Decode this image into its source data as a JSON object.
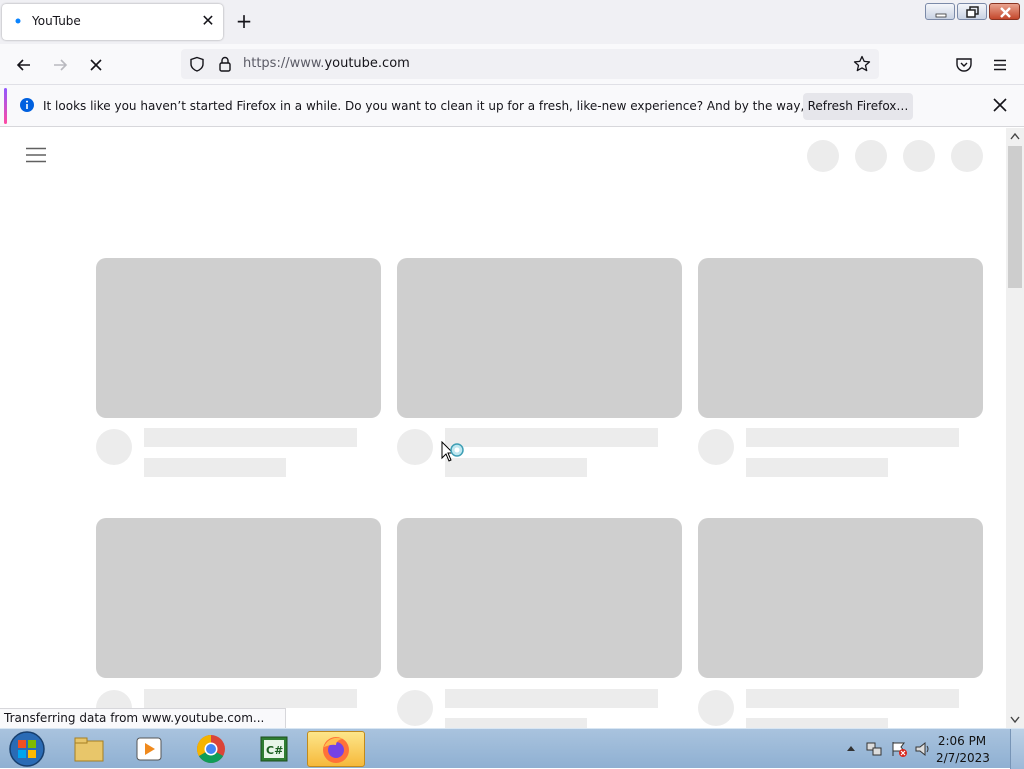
{
  "browser": {
    "tab_title": "YouTube",
    "new_tab_symbol": "+",
    "url_scheme": "https://www.",
    "url_host": "youtube.com",
    "status_text": "Transferring data from www.youtube.com..."
  },
  "notification": {
    "message": "It looks like you haven’t started Firefox in a while. Do you want to clean it up for a fresh, like-new experience? And by the way, welcome back!",
    "button_label": "Refresh Firefox…"
  },
  "taskbar": {
    "apps": [
      "windows-start-orb",
      "file-explorer",
      "media-player",
      "chrome",
      "csharp-editor",
      "firefox"
    ],
    "active_app": "firefox",
    "clock_time": "2:06 PM",
    "clock_date": "2/7/2023"
  },
  "page": {
    "state": "loading",
    "skeleton_rows_visible": 2,
    "skeleton_cards_per_row": 3
  },
  "colors": {
    "skeleton_thumb": "#cfcfcf",
    "skeleton_text": "#ececec",
    "youtube_favicon": "#0a84ff",
    "info_icon": "#0060df"
  }
}
